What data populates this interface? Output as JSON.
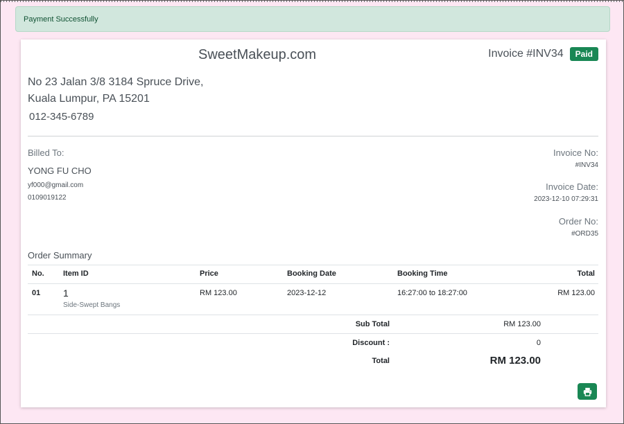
{
  "alert": {
    "message": "Payment Successfully"
  },
  "header": {
    "brand": "SweetMakeup.com",
    "invoice_title": "Invoice #INV34",
    "status_badge": "Paid"
  },
  "company": {
    "address_line1": "No 23 Jalan 3/8 3184 Spruce Drive,",
    "address_line2": "Kuala Lumpur, PA 15201",
    "phone": "012-345-6789"
  },
  "billed_to": {
    "label": "Billed To:",
    "name": "YONG FU CHO",
    "email": "yf000@gmail.com",
    "phone": "0109019122"
  },
  "invoice_meta": {
    "invoice_no_label": "Invoice No:",
    "invoice_no": "#INV34",
    "invoice_date_label": "Invoice Date:",
    "invoice_date": "2023-12-10 07:29:31",
    "order_no_label": "Order No:",
    "order_no": "#ORD35"
  },
  "order_summary": {
    "title": "Order Summary",
    "columns": [
      "No.",
      "Item ID",
      "Price",
      "Booking Date",
      "Booking Time",
      "Total"
    ],
    "rows": [
      {
        "no": "01",
        "item_id": "1",
        "item_name": "Side-Swept Bangs",
        "price": "RM 123.00",
        "booking_date": "2023-12-12",
        "booking_time": "16:27:00 to 18:27:00",
        "total": "RM 123.00"
      }
    ],
    "sub_total_label": "Sub Total",
    "sub_total": "RM 123.00",
    "discount_label": "Discount :",
    "discount": "0",
    "total_label": "Total",
    "total": "RM 123.00"
  },
  "icons": {
    "print": "printer-icon"
  },
  "colors": {
    "accent": "#198754",
    "alert_bg": "#d1e7dd",
    "page_bg": "#fde7f3"
  }
}
